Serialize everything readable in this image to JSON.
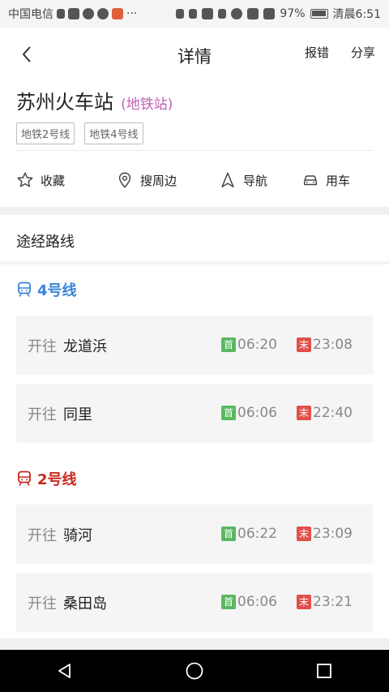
{
  "status_bar": {
    "carrier": "中国电信",
    "dots": "···",
    "battery": "97%",
    "time": "清晨6:51"
  },
  "header": {
    "title": "详情",
    "report": "报错",
    "share": "分享"
  },
  "station": {
    "name": "苏州火车站",
    "type": "(地铁站)",
    "tags": [
      "地铁2号线",
      "地铁4号线"
    ]
  },
  "actions": {
    "favorite": "收藏",
    "nearby": "搜周边",
    "navigate": "导航",
    "car": "用车"
  },
  "routes_title": "途经路线",
  "lines": [
    {
      "name": "4号线",
      "color": "#3a84d8",
      "trips": [
        {
          "dir": "开往",
          "dest": "龙道浜",
          "first_badge": "首",
          "first": "06:20",
          "last_badge": "末",
          "last": "23:08"
        },
        {
          "dir": "开往",
          "dest": "同里",
          "first_badge": "首",
          "first": "06:06",
          "last_badge": "末",
          "last": "22:40"
        }
      ]
    },
    {
      "name": "2号线",
      "color": "#c8281e",
      "trips": [
        {
          "dir": "开往",
          "dest": "骑河",
          "first_badge": "首",
          "first": "06:22",
          "last_badge": "末",
          "last": "23:09"
        },
        {
          "dir": "开往",
          "dest": "桑田岛",
          "first_badge": "首",
          "first": "06:06",
          "last_badge": "末",
          "last": "23:21"
        }
      ]
    }
  ]
}
